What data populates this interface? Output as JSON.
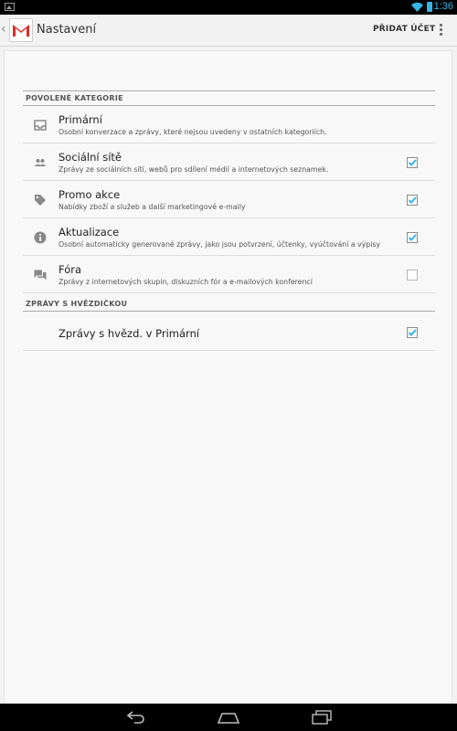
{
  "status_bar": {
    "time": "1:36",
    "icons": [
      "gallery-icon",
      "wifi-icon",
      "battery-icon"
    ],
    "accent_color": "#33b5e5"
  },
  "action_bar": {
    "title": "Nastavení",
    "add_account_label": "PŘIDAT ÚČET",
    "icons": [
      "up-caret-icon",
      "gmail-logo-icon",
      "overflow-menu-icon"
    ]
  },
  "sections": {
    "categories_header": "POVOLENÉ KATEGORIE",
    "starred_header": "ZPRÁVY S HVĚZDIČKOU"
  },
  "categories": [
    {
      "title": "Primární",
      "subtitle": "Osobní konverzace a zprávy, které nejsou uvedeny v ostatních kategoriích.",
      "icon": "inbox-icon",
      "checkbox": "none"
    },
    {
      "title": "Sociální sítě",
      "subtitle": "Zprávy ze sociálních sítí, webů pro sdílení médií a internetových seznamek.",
      "icon": "people-icon",
      "checkbox": "checked"
    },
    {
      "title": "Promo akce",
      "subtitle": "Nabídky zboží a služeb a další marketingové e-maily",
      "icon": "tag-icon",
      "checkbox": "checked"
    },
    {
      "title": "Aktualizace",
      "subtitle": "Osobní automaticky generované zprávy, jako jsou potvrzení, účtenky, vyúčtování a výpisy",
      "icon": "info-icon",
      "checkbox": "checked"
    },
    {
      "title": "Fóra",
      "subtitle": "Zprávy z internetových skupin, diskuzních fór a e-mailových konferencí",
      "icon": "forum-icon",
      "checkbox": "unchecked"
    }
  ],
  "starred": {
    "title": "Zprávy s hvězd. v Primární",
    "checkbox": "checked"
  },
  "nav_bar": {
    "icons": [
      "back-icon",
      "home-icon",
      "recent-apps-icon"
    ]
  },
  "colors": {
    "checkbox_checked": "#33b5e5",
    "background": "#f2f2f2"
  }
}
